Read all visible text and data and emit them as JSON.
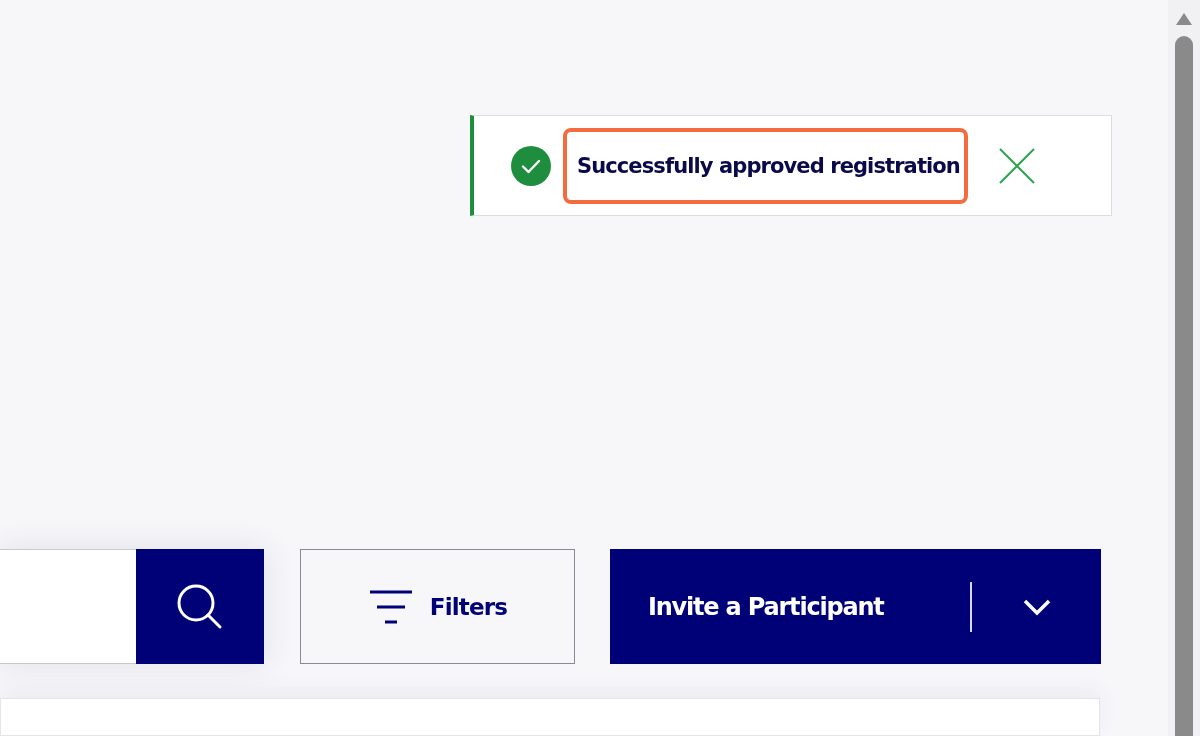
{
  "toast": {
    "message": "Successfully approved registration",
    "highlighted": true
  },
  "toolbar": {
    "filters_button": "Filters",
    "invite_button": "Invite a Participant"
  }
}
